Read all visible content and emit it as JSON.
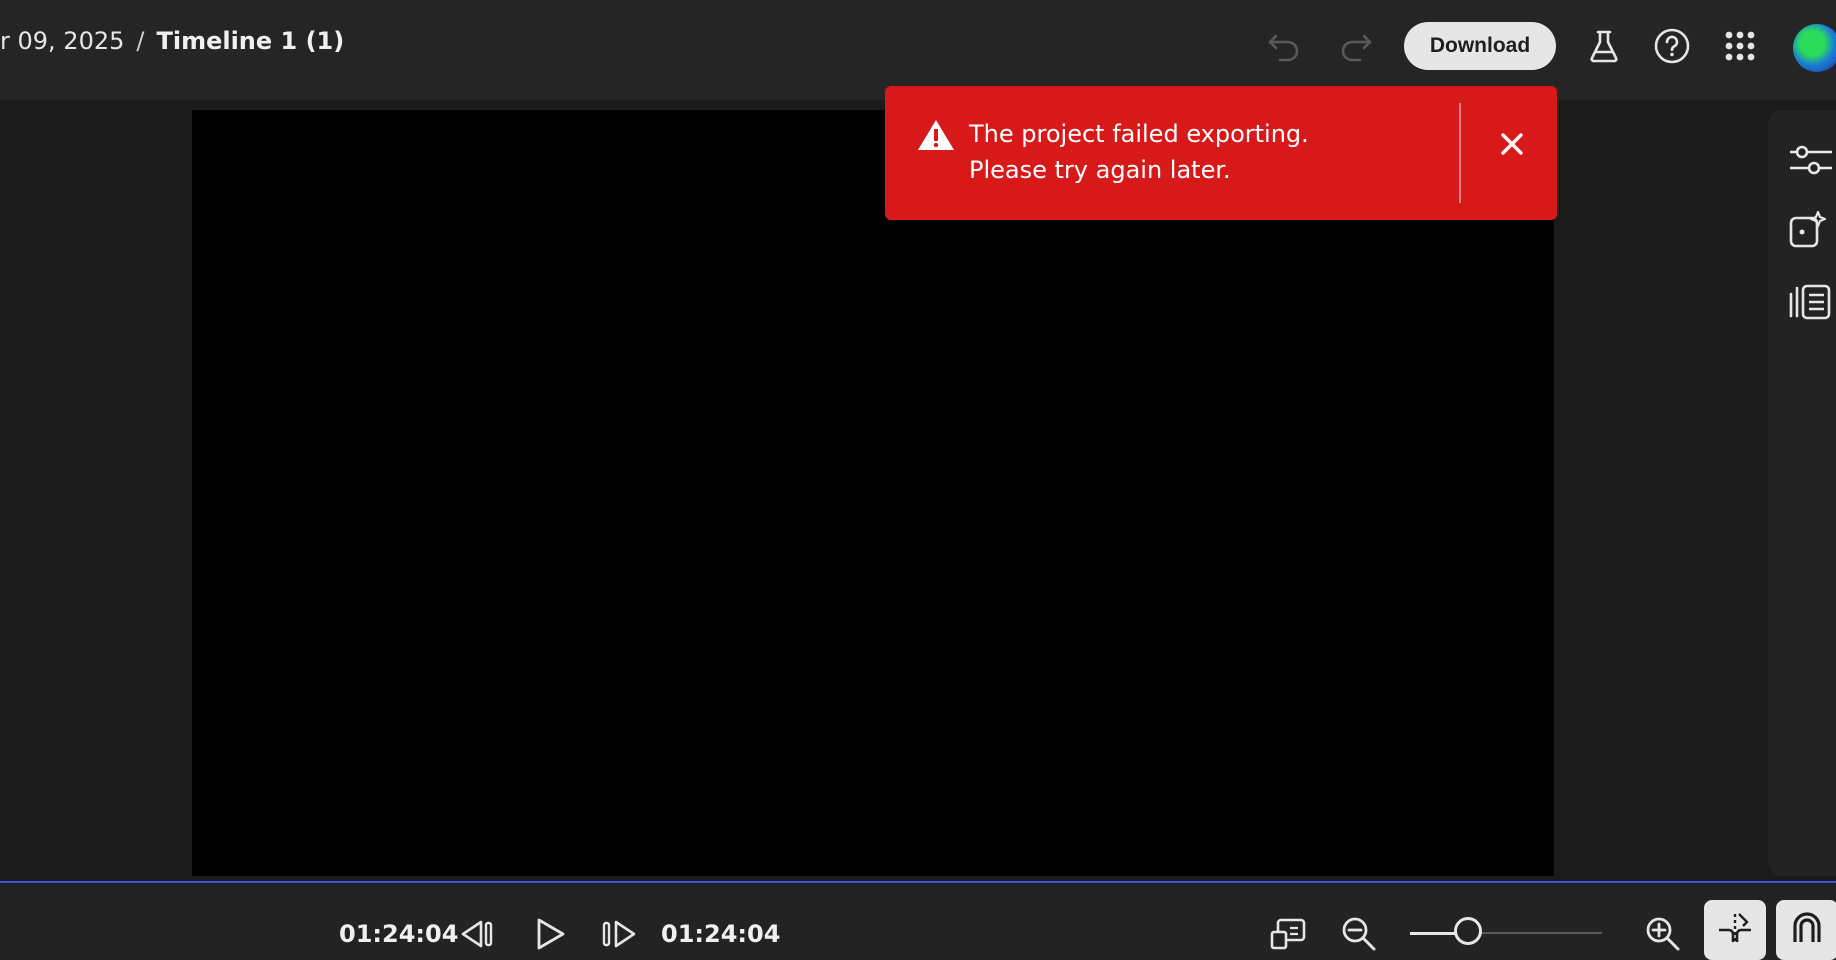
{
  "header": {
    "breadcrumb_date": "r 09, 2025",
    "breadcrumb_sep": "/",
    "breadcrumb_current": "Timeline 1 (1)",
    "download_label": "Download"
  },
  "toast": {
    "message": "The project failed exporting. Please try again later.",
    "color": "#d7191a"
  },
  "playback": {
    "current_time": "01:24:04",
    "duration": "01:24:04",
    "zoom_level": 0.3
  },
  "icons": {
    "undo": "undo-icon",
    "redo": "redo-icon",
    "labs": "beaker-icon",
    "help": "help-icon",
    "apps": "apps-grid-icon",
    "adjust": "sliders-icon",
    "effects": "magic-sparkle-icon",
    "captions": "captions-list-icon"
  },
  "colors": {
    "accent": "#3b5bdb",
    "error": "#d7191a"
  }
}
